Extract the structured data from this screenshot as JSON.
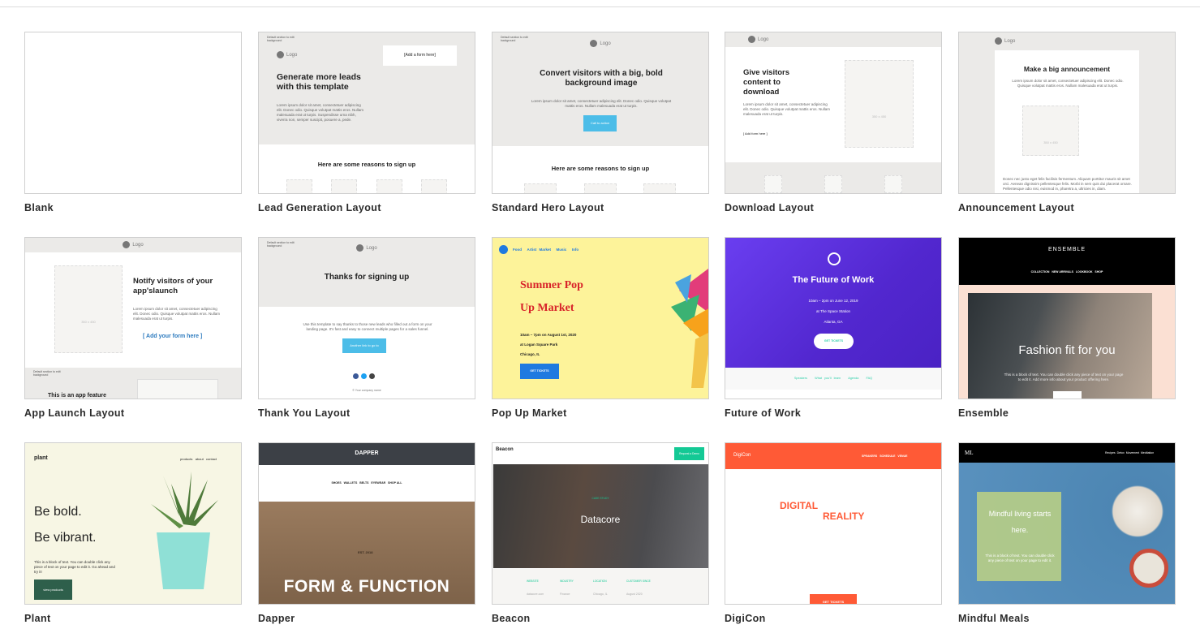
{
  "templates": [
    {
      "name": "Blank"
    },
    {
      "name": "Lead Generation Layout",
      "hint": "Default section to edit background",
      "logo": "Logo",
      "form": "[Add a form here]",
      "headline": "Generate more leads with this template",
      "body": "Lorem ipsum dolor sit amet, consectetuer adipiscing elit. Donec odio. Quisque volutpat mattis eros. Nullam malesuada erat ut turpis. Suspendisse urna nibh, viverra non, semper suscipit, posuere a, pede.",
      "section": "Here are some reasons to sign up"
    },
    {
      "name": "Standard Hero Layout",
      "hint": "Default section to edit background",
      "logo": "Logo",
      "headline": "Convert visitors with a big, bold background image",
      "body": "Lorem ipsum dolor sit amet, consectetuer adipiscing elit. Donec odio. Quisque volutpat mattis eros. Nullam malesuada erat ut turpis.",
      "cta": "Call to action",
      "section": "Here are some reasons to sign up"
    },
    {
      "name": "Download Layout",
      "logo": "Logo",
      "headline": "Give visitors content to download",
      "body": "Lorem ipsum dolor sit amet, consectetuer adipiscing elit. Donec odio. Quisque volutpat mattis eros. Nullam malesuada erat ut turpis.",
      "form": "[ Add form here ]",
      "img": "350 x 450"
    },
    {
      "name": "Announcement Layout",
      "logo": "Logo",
      "headline": "Make a big announcement",
      "body": "Lorem ipsum dolor sit amet, consectetuer adipiscing elit. Donec odio. Quisque volutpat mattis eros. Nullam malesuada erat ut turpis.",
      "img": "350 x 450",
      "body2": "Donec nec justo eget felis facilisis fermentum. Aliquam porttitor mauris sit amet orci. Aenean dignissim pellentesque felis. Morbi in sem quis dui placerat ornare. Pellentesque odio nisi, euismod in, pharetra a, ultricies in, diam."
    },
    {
      "name": "App Launch Layout",
      "logo": "Logo",
      "headline": "Notify visitors of your app'slaunch",
      "body": "Lorem ipsum dolor sit amet, consectetuer adipiscing elit. Donec odio. Quisque volutpat mattis eros. Nullam malesuada erat ut turpis.",
      "form": "[ Add your form here ]",
      "img": "350 x 450",
      "hint": "Default section to edit background",
      "feature": "This is an app feature"
    },
    {
      "name": "Thank You Layout",
      "hint": "Default section to edit background",
      "logo": "Logo",
      "headline": "Thanks for signing up",
      "body": "Use this template to say thanks to those new leads who filled out a form on your landing page. It's fast and easy to connect multiple pages for a sales funnel.",
      "cta": "Another link to go to",
      "footer": "© Your company name"
    },
    {
      "name": "Pop Up Market",
      "nav": [
        "Food",
        "Artist Market",
        "Music",
        "Info"
      ],
      "title1": "Summer Pop",
      "title2": "Up Market",
      "details": [
        "10am – 7pm on August 1st, 2020",
        "at Logan Square Park",
        "Chicago, IL"
      ],
      "cta": "GET TICKETS"
    },
    {
      "name": "Future of Work",
      "headline": "The Future of Work",
      "details": [
        "10am – 2pm on June 12, 2019",
        "at The Space Station",
        "Atlanta, GA"
      ],
      "cta": "GET TICKETS",
      "links": [
        "Speakers",
        "What you'll learn",
        "Agenda",
        "FAQ"
      ]
    },
    {
      "name": "Ensemble",
      "brand": "ENSEMBLE",
      "nav": [
        "COLLECTION",
        "NEW ARRIVALS",
        "LOOKBOOK",
        "SHOP"
      ],
      "headline": "Fashion fit for you",
      "body": "This is a block of text. You can double click any piece of text on your page to edit it. Add more info about your product offering here."
    },
    {
      "name": "Plant",
      "brand": "plant",
      "nav": [
        "products",
        "about",
        "contact"
      ],
      "line1": "Be bold.",
      "line2": "Be vibrant.",
      "body": "This is a block of text. You can double click any piece of text on your page to edit it. Go ahead and try it!",
      "cta": "view products"
    },
    {
      "name": "Dapper",
      "brand": "DAPPER",
      "nav": [
        "SHOES",
        "WALLETS",
        "BELTS",
        "EYEWEAR",
        "SHOP ALL"
      ],
      "est": "EST. 2018",
      "headline": "FORM & FUNCTION"
    },
    {
      "name": "Beacon",
      "brand": "Beacon",
      "cta": "Request a Demo",
      "eyebrow": "CASE STUDY",
      "headline": "Datacore",
      "cols": [
        {
          "k": "WEBSITE",
          "v": "datacore.com"
        },
        {
          "k": "INDUSTRY",
          "v": "Finance"
        },
        {
          "k": "LOCATION",
          "v": "Chicago, IL"
        },
        {
          "k": "CUSTOMER SINCE",
          "v": "August 2020"
        }
      ]
    },
    {
      "name": "DigiCon",
      "brand": "DigiCon",
      "nav": [
        "SPEAKERS",
        "SCHEDULE",
        "VENUE"
      ],
      "line1": "DIGITAL",
      "line2": "REALITY",
      "cta": "GET TICKETS"
    },
    {
      "name": "Mindful Meals",
      "brand": "ML",
      "nav": [
        "Recipes",
        "Detox",
        "Movement",
        "Meditation"
      ],
      "headline": "Mindful living starts here.",
      "body": "This is a block of text. You can double click any piece of text on your page to edit it."
    }
  ],
  "colors": {
    "cta_blue": "#4cbde8",
    "popup_yellow": "#fdf39a",
    "popup_red": "#d8232a",
    "future_purple": "#5b2fd6",
    "digicon_orange": "#ff5a36",
    "beacon_green": "#14c995",
    "plant_green": "#2e5f4b"
  }
}
